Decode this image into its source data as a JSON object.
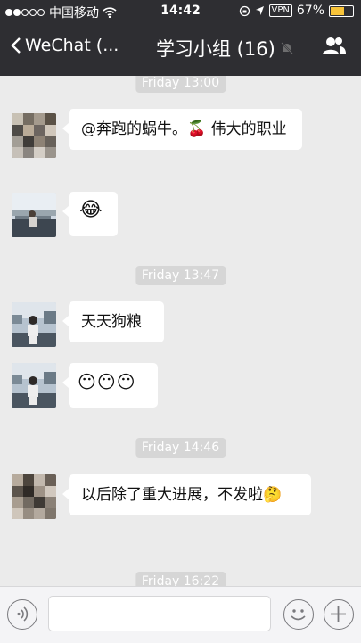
{
  "status_bar": {
    "carrier": "中国移动",
    "time": "14:42",
    "vpn": "VPN",
    "battery": "67%",
    "battery_level": 0.67
  },
  "nav": {
    "back_label": "WeChat (...",
    "title": "学习小组 (16)",
    "mute_icon": "bell-off-icon",
    "members_icon": "people-icon"
  },
  "messages": [
    {
      "time": "Friday 13:00",
      "text": "@奔跑的蜗牛。🍒 伟大的职业"
    },
    {
      "emoji": "😂"
    },
    {
      "time": "Friday 13:47",
      "text": "天天狗粮"
    },
    {
      "emoji": "😶😶😶"
    },
    {
      "time": "Friday 14:46",
      "text": "以后除了重大进展，不发啦🤔"
    },
    {
      "time": "Friday 16:22"
    }
  ],
  "bottom": {
    "voice_icon": "voice-icon",
    "emoji_icon": "smile-icon",
    "plus_icon": "plus-icon"
  }
}
